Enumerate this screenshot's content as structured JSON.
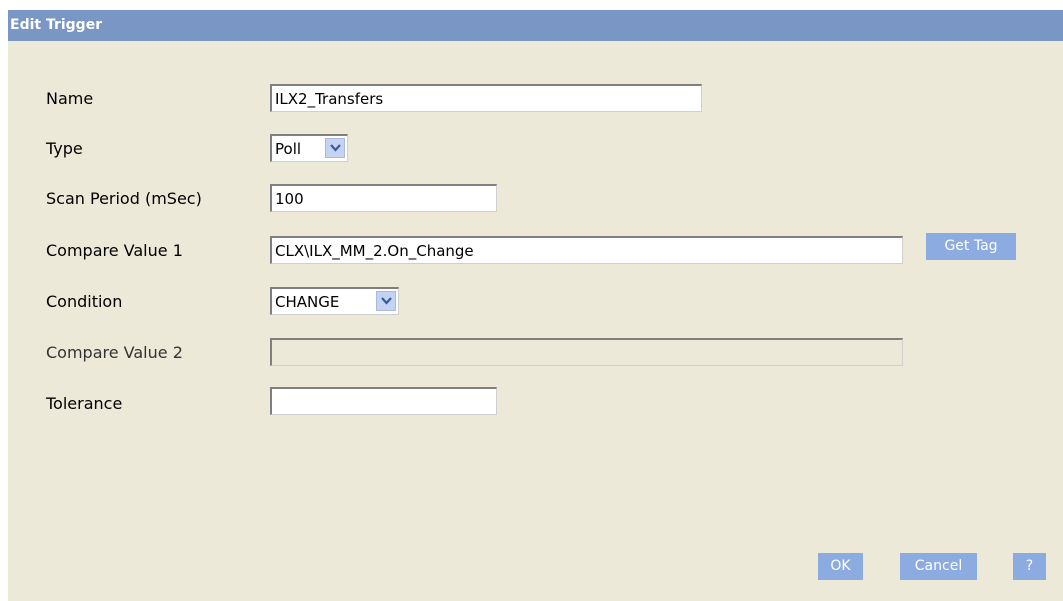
{
  "dialog": {
    "title": "Edit Trigger"
  },
  "fields": {
    "name": {
      "label": "Name",
      "value": "ILX2_Transfers"
    },
    "type": {
      "label": "Type",
      "value": "Poll"
    },
    "scan_period": {
      "label": "Scan Period (mSec)",
      "value": "100"
    },
    "compare_value_1": {
      "label": "Compare Value 1",
      "value": "CLX\\ILX_MM_2.On_Change"
    },
    "condition": {
      "label": "Condition",
      "value": "CHANGE"
    },
    "compare_value_2": {
      "label": "Compare Value 2",
      "value": ""
    },
    "tolerance": {
      "label": "Tolerance",
      "value": ""
    }
  },
  "buttons": {
    "get_tag": "Get Tag",
    "ok": "OK",
    "cancel": "Cancel",
    "help": "?"
  },
  "colors": {
    "title_bar": "#7a96c4",
    "dialog_bg": "#ece9d8",
    "button_bg": "#8cabe0",
    "dropdown_arrow_bg": "#c4d3f2"
  }
}
